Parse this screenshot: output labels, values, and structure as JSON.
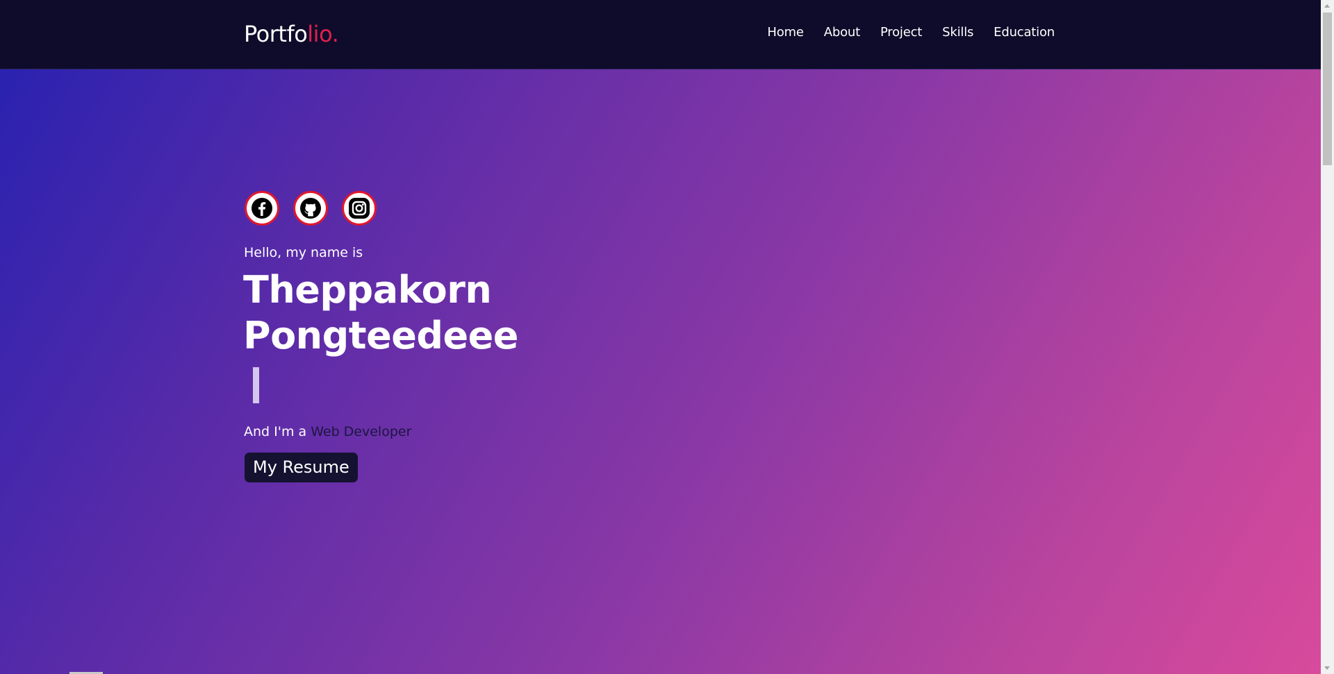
{
  "header": {
    "logo_main": "Portfo",
    "logo_accent": "lio.",
    "nav": [
      {
        "label": "Home"
      },
      {
        "label": "About"
      },
      {
        "label": "Project"
      },
      {
        "label": "Skills"
      },
      {
        "label": "Education"
      }
    ]
  },
  "hero": {
    "socials": [
      {
        "icon": "facebook-icon"
      },
      {
        "icon": "github-icon"
      },
      {
        "icon": "instagram-icon"
      }
    ],
    "greeting": "Hello, my name is",
    "name_line1": "Theppakorn",
    "name_line2": "Pongteedeee",
    "role_prefix": "And I'm a",
    "role": "Web Developer",
    "resume_label": "My Resume"
  },
  "colors": {
    "navbar_bg": "#0e0c2a",
    "logo_accent": "#e0204e",
    "gradient_start": "#2a22b0",
    "gradient_end": "#d84a9c",
    "social_ring": "#e0182e",
    "button_bg": "#141230"
  }
}
